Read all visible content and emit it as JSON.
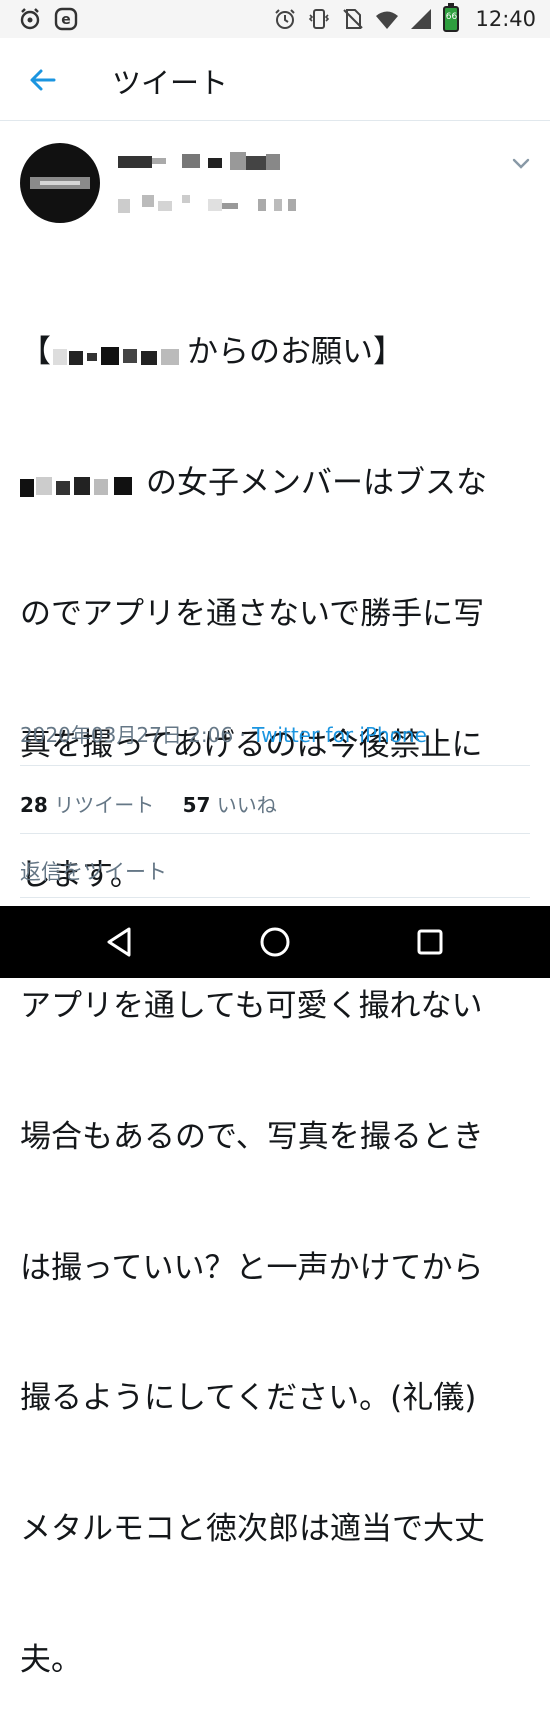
{
  "status_bar": {
    "time": "12:40",
    "battery_level": "66",
    "icons": [
      "alarm-icon",
      "e-app-icon",
      "alarm-clock-icon",
      "vibrate-icon",
      "no-sim-icon",
      "wifi-icon",
      "signal-icon",
      "battery-icon"
    ]
  },
  "header": {
    "title": "ツイート",
    "back_icon": "arrow-left-icon"
  },
  "tweet": {
    "lines": [
      "【",
      "からのお願い】",
      "の女子メンバーはブスな",
      "のでアプリを通さないで勝手に写",
      "真を撮ってあげるのは今後禁止に",
      "します。",
      "アプリを通しても可愛く撮れない",
      "場合もあるので、写真を撮るとき",
      "は撮っていい？と一声かけてから",
      "撮るようにしてください。(礼儀)",
      "メタルモコと徳次郎は適当で大丈",
      "夫。"
    ],
    "timestamp": "2020年03月27日 2:06",
    "separator": " · ",
    "source": "Twitter for iPhone"
  },
  "stats": {
    "retweets_count": "28",
    "retweets_label": "リツイート",
    "likes_count": "57",
    "likes_label": "いいね"
  },
  "reply": {
    "placeholder": "返信をツイート"
  },
  "colors": {
    "accent": "#1b95e0",
    "secondary_text": "#657786",
    "primary_text": "#14171a",
    "divider": "#e1e8ed"
  }
}
